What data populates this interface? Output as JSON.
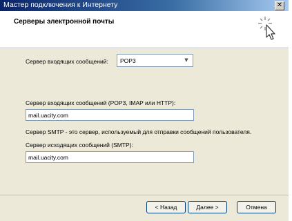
{
  "window": {
    "title": "Мастер подключения к Интернету",
    "close_glyph": "✕"
  },
  "header": {
    "title": "Серверы электронной почты",
    "icon": "wizard-wand-icon"
  },
  "form": {
    "incoming_type_label": "Сервер входящих сообщений:",
    "incoming_type_value": "POP3",
    "incoming_type_arrow": "▼",
    "incoming_server_label": "Сервер входящих сообщений (POP3, IMAP или HTTP):",
    "incoming_server_value": "mail.uacity.com",
    "smtp_note": "Сервер SMTP - это сервер, используемый для отправки сообщений пользователя.",
    "outgoing_server_label": "Сервер исходящих сообщений (SMTP):",
    "outgoing_server_value": "mail.uacity.com"
  },
  "buttons": {
    "back": "< Назад",
    "next": "Далее >",
    "cancel": "Отмена"
  },
  "colors": {
    "dialog_bg": "#ece9d8",
    "header_bg": "#ffffff",
    "title_gradient_start": "#0a246a",
    "title_gradient_end": "#a6caf0",
    "input_border": "#7f9db9",
    "button_border": "#003c74"
  }
}
